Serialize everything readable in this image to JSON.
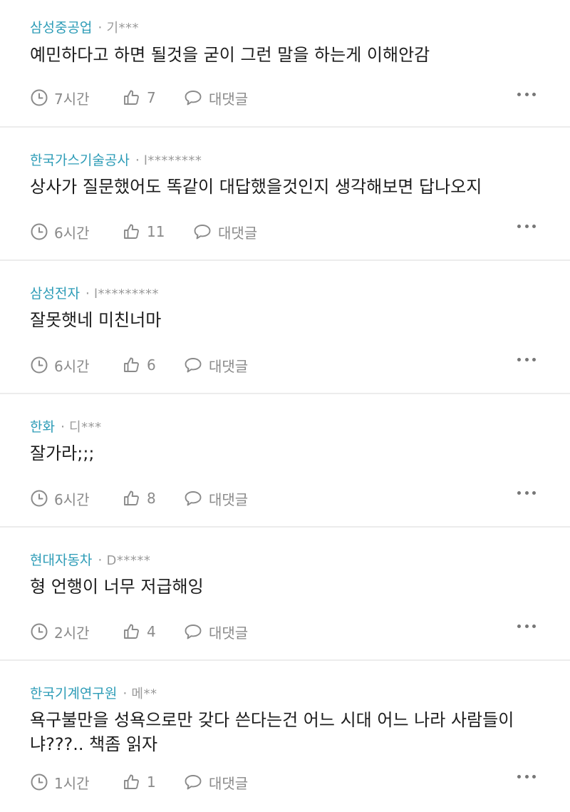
{
  "comments": [
    {
      "company": "삼성중공업",
      "separator": "·",
      "author": "기***",
      "text": "예민하다고 하면 될것을 굳이 그런 말을 하는게 이해안감",
      "time": "7시간",
      "likes": "7",
      "reply": "대댓글"
    },
    {
      "company": "한국가스기술공사",
      "separator": "·",
      "author": "l********",
      "text": "상사가 질문했어도 똑같이 대답했을것인지 생각해보면 답나오지",
      "time": "6시간",
      "likes": "11",
      "reply": "대댓글"
    },
    {
      "company": "삼성전자",
      "separator": "·",
      "author": "l*********",
      "text": "잘못햇네 미친너마",
      "time": "6시간",
      "likes": "6",
      "reply": "대댓글"
    },
    {
      "company": "한화",
      "separator": "·",
      "author": "디***",
      "text": "잘가라;;;",
      "time": "6시간",
      "likes": "8",
      "reply": "대댓글"
    },
    {
      "company": "현대자동차",
      "separator": "·",
      "author": "D*****",
      "text": "형 언행이 너무 저급해잉",
      "time": "2시간",
      "likes": "4",
      "reply": "대댓글"
    },
    {
      "company": "한국기계연구원",
      "separator": "·",
      "author": "메**",
      "text": "욕구불만을 성욕으로만 갖다 쓴다는건 어느 시대 어느 나라 사람들이냐???.. 책좀 읽자",
      "time": "1시간",
      "likes": "1",
      "reply": "대댓글"
    }
  ],
  "icons": {
    "time": "clock-icon",
    "like": "thumbs-up-icon",
    "reply": "speech-bubble-icon",
    "more": "more-horizontal-icon"
  },
  "colors": {
    "company": "#2d9cb7",
    "text": "#1d1d1d",
    "muted": "#8a8a8a",
    "divider": "#ececec"
  }
}
